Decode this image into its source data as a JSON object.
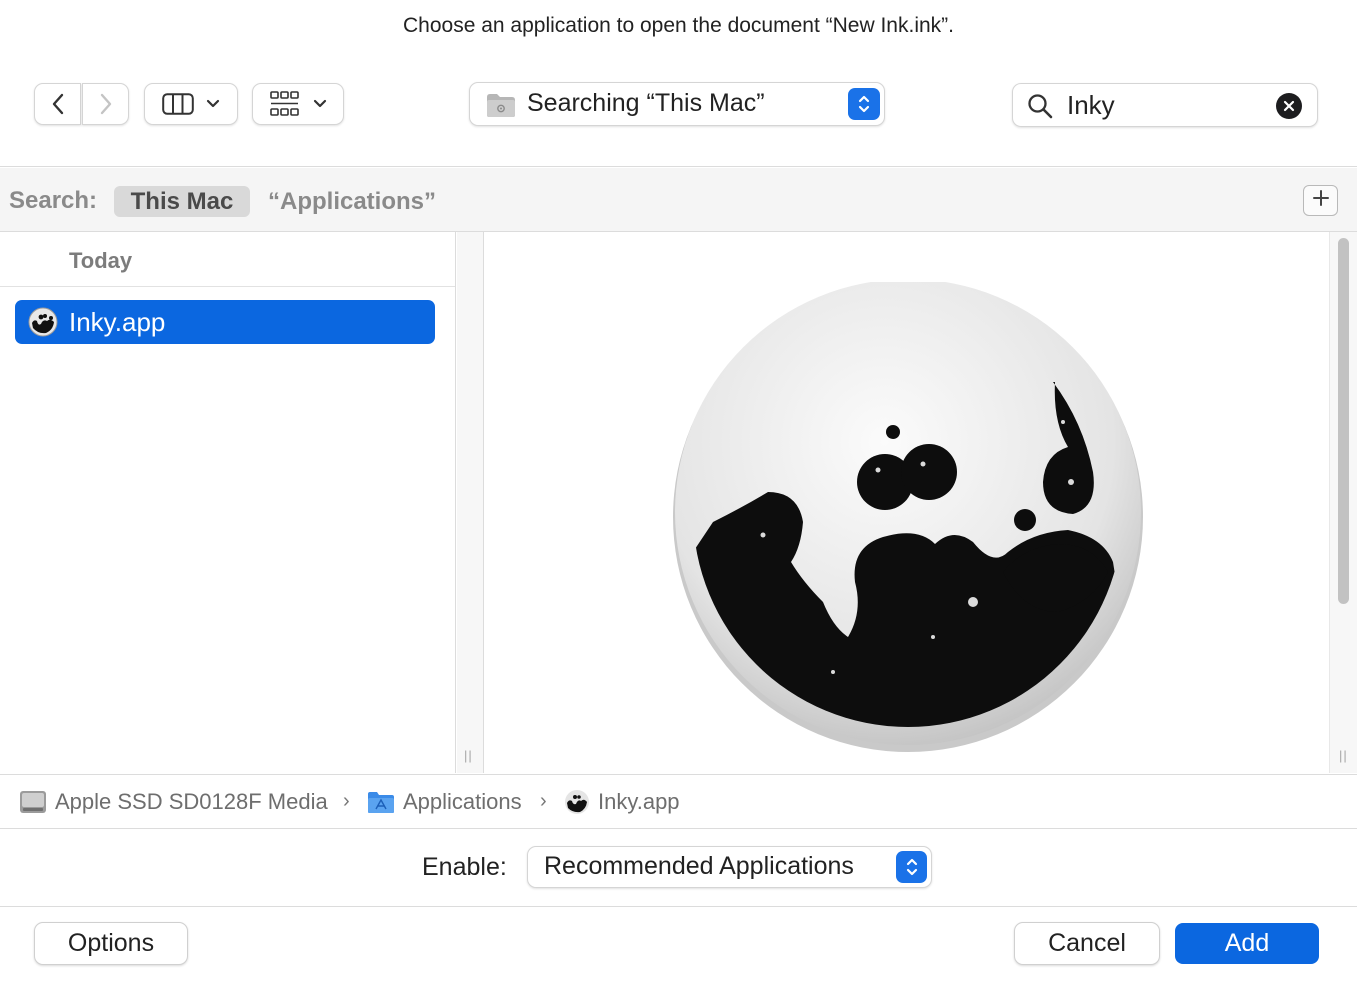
{
  "prompt": "Choose an application to open the document “New Ink.ink”.",
  "toolbar": {
    "location": "Searching “This Mac”",
    "search_value": "Inky"
  },
  "scope": {
    "label": "Search:",
    "this_mac": "This Mac",
    "applications": "“Applications”"
  },
  "results": {
    "group_header": "Today",
    "items": [
      {
        "name": "Inky.app",
        "selected": true
      }
    ]
  },
  "pathbar": {
    "crumbs": [
      "Apple SSD SD0128F Media",
      "Applications",
      "Inky.app"
    ]
  },
  "enable": {
    "label": "Enable:",
    "value": "Recommended Applications"
  },
  "buttons": {
    "options": "Options",
    "cancel": "Cancel",
    "add": "Add"
  },
  "colors": {
    "accent": "#0b67e0",
    "selection": "#0b67e0"
  },
  "icons": [
    "chevron-left-icon",
    "chevron-right-icon",
    "column-view-icon",
    "grid-view-icon",
    "folder-icon",
    "updown-stepper-icon",
    "search-icon",
    "clear-icon",
    "plus-icon",
    "inky-app-icon",
    "hard-drive-icon",
    "applications-folder-icon"
  ]
}
